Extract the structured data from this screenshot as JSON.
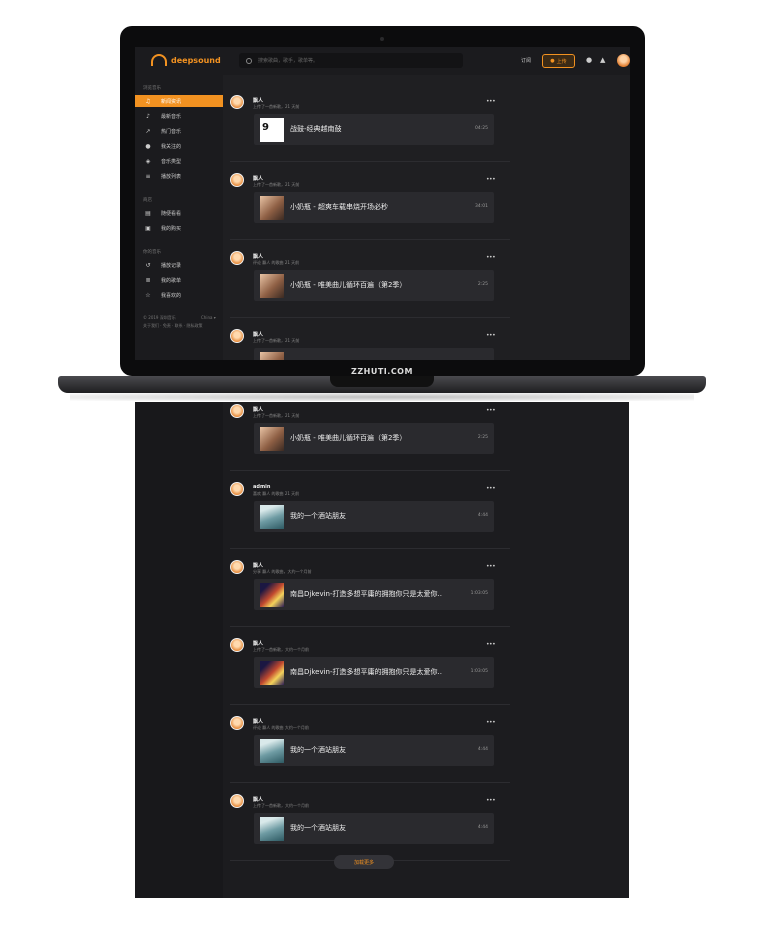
{
  "watermark": "ZZHUTI.COM",
  "app": {
    "logo": "deepsound",
    "search_placeholder": "搜索歌曲，歌手，歌单等。",
    "subscribe": "订阅",
    "upload": "上传"
  },
  "sidebar": {
    "section1": "浏览音乐",
    "items1": [
      {
        "label": "新闻资讯",
        "icon": "music-note-icon"
      },
      {
        "label": "最新音乐",
        "icon": "note-icon"
      },
      {
        "label": "热门音乐",
        "icon": "chart-icon"
      },
      {
        "label": "我关注的",
        "icon": "drop-icon"
      },
      {
        "label": "音乐类型",
        "icon": "layers-icon"
      },
      {
        "label": "播放列表",
        "icon": "playlist-icon"
      }
    ],
    "section2": "商店",
    "items2": [
      {
        "label": "随便看看",
        "icon": "store-icon"
      },
      {
        "label": "我的购买",
        "icon": "bag-icon"
      }
    ],
    "section3": "你的音乐",
    "items3": [
      {
        "label": "播放记录",
        "icon": "history-icon"
      },
      {
        "label": "我的歌单",
        "icon": "queue-icon"
      },
      {
        "label": "我喜欢的",
        "icon": "star-icon"
      }
    ],
    "footer1": "© 2019 深圳音乐",
    "footer_lang": "China ▾",
    "footer2": "关于我们 · 免责 · 联系 · 隐私政策"
  },
  "posts": [
    {
      "user": "飘人",
      "meta": "上传了一首新歌，21 天前",
      "title": "战鼓-经典越南鼓",
      "duration": "04:25",
      "cover": "cov-92"
    },
    {
      "user": "飘人",
      "meta": "上传了一首新歌，21 天前",
      "title": "小奶瓶 - 超爽车载串烧开场必秒",
      "duration": "34:01",
      "cover": "cov-girl"
    },
    {
      "user": "飘人",
      "meta": "评论 飘人 的歌曲 21 天前",
      "title": "小奶瓶 - 唯美曲儿循环百遍（第2季）",
      "duration": "2:25",
      "cover": "cov-girl"
    },
    {
      "user": "飘人",
      "meta": "上传了一首新歌，21 天前",
      "title": "",
      "duration": "",
      "cover": "cov-girl"
    }
  ],
  "posts_below": [
    {
      "user": "飘人",
      "meta": "上传了一首新歌，21 天前",
      "title": "小奶瓶 - 唯美曲儿循环百遍（第2季）",
      "duration": "2:25",
      "cover": "cov-girl"
    },
    {
      "user": "admin",
      "meta": "喜欢 飘人 的歌曲 21 天前",
      "title": "我的一个酒站朋友",
      "duration": "4:44",
      "cover": "cov-sea"
    },
    {
      "user": "飘人",
      "meta": "分享 飘人 的歌曲，大约一个月前",
      "title": "南昌Djkevin-打造多想平庸的拥抱你只是太爱你..",
      "duration": "1:03:05",
      "cover": "cov-dj"
    },
    {
      "user": "飘人",
      "meta": "上传了一首新歌，大约一个月前",
      "title": "南昌Djkevin-打造多想平庸的拥抱你只是太爱你..",
      "duration": "1:03:05",
      "cover": "cov-dj"
    },
    {
      "user": "飘人",
      "meta": "评论 飘人 的歌曲 大约一个月前",
      "title": "我的一个酒站朋友",
      "duration": "4:44",
      "cover": "cov-sea"
    },
    {
      "user": "飘人",
      "meta": "上传了一首新歌，大约一个月前",
      "title": "我的一个酒站朋友",
      "duration": "4:44",
      "cover": "cov-sea"
    }
  ],
  "load_more": "加载更多"
}
